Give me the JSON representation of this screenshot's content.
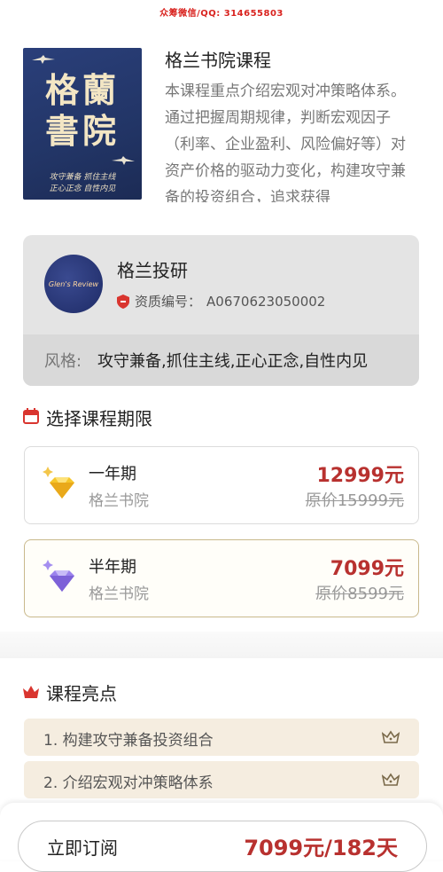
{
  "watermark": "众筹微信/QQ: 314655803",
  "course": {
    "cover_title_line1": "格蘭",
    "cover_title_line2": "書院",
    "cover_sub_line1": "攻守兼备 抓住主线",
    "cover_sub_line2": "正心正念 自性内见",
    "title": "格兰书院课程",
    "description": "本课程重点介绍宏观对冲策略体系。通过把握周期规律，判断宏观因子（利率、企业盈利、风险偏好等）对资产价格的驱动力变化，构建攻守兼备的投资组合，追求获得"
  },
  "author": {
    "avatar_text": "Glen's Review",
    "name": "格兰投研",
    "cert_label": "资质编号：",
    "cert_number": "A0670623050002",
    "style_label": "风格:",
    "style_value": "攻守兼备,抓住主线,正心正念,自性内见"
  },
  "period_section": {
    "title": "选择课程期限",
    "icon": "calendar-icon",
    "plans": [
      {
        "name": "一年期",
        "org": "格兰书院",
        "price": "12999元",
        "original": "原价15999元",
        "gem": "gold-diamond",
        "selected": false
      },
      {
        "name": "半年期",
        "org": "格兰书院",
        "price": "7099元",
        "original": "原价8599元",
        "gem": "purple-diamond",
        "selected": true
      }
    ]
  },
  "highlights_section": {
    "title": "课程亮点",
    "icon": "crown-icon",
    "items": [
      {
        "text": "1. 构建攻守兼备投资组合"
      },
      {
        "text": "2. 介绍宏观对冲策略体系"
      }
    ]
  },
  "bottom_bar": {
    "subscribe_label": "立即订阅",
    "price_label": "7099元/182天"
  },
  "colors": {
    "accent_red": "#b8312f",
    "cover_blue": "#223566",
    "highlight_bg": "#f5ede0"
  }
}
